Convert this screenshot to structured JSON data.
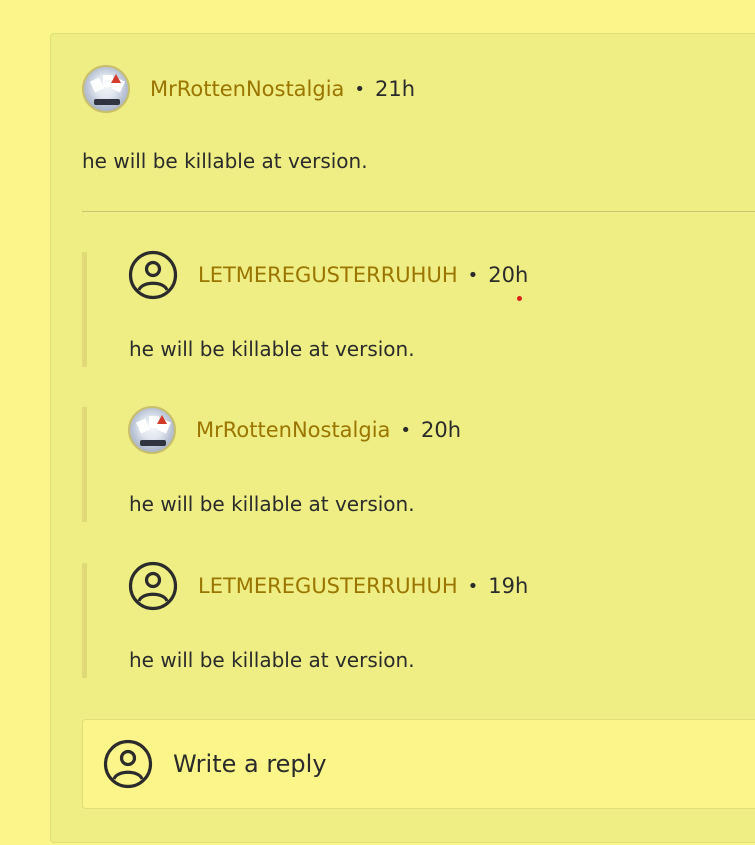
{
  "comment": {
    "username": "MrRottenNostalgia",
    "separator": "•",
    "time": "21h",
    "text": "he will be killable at version."
  },
  "replies": [
    {
      "username": "LETMEREGUSTERRUHUH",
      "separator": "•",
      "time": "20h",
      "text": "he will be killable at version.",
      "avatar": "user-circle-icon"
    },
    {
      "username": "MrRottenNostalgia",
      "separator": "•",
      "time": "20h",
      "text": "he will be killable at version.",
      "avatar": "profile-image"
    },
    {
      "username": "LETMEREGUSTERRUHUH",
      "separator": "•",
      "time": "19h",
      "text": "he will be killable at version.",
      "avatar": "user-circle-icon"
    }
  ],
  "reply_input": {
    "placeholder": "Write a reply"
  },
  "colors": {
    "page_bg": "#fcf68a",
    "card_bg": "#eeee84",
    "username": "#9a7500",
    "text": "#2b2b2b"
  }
}
